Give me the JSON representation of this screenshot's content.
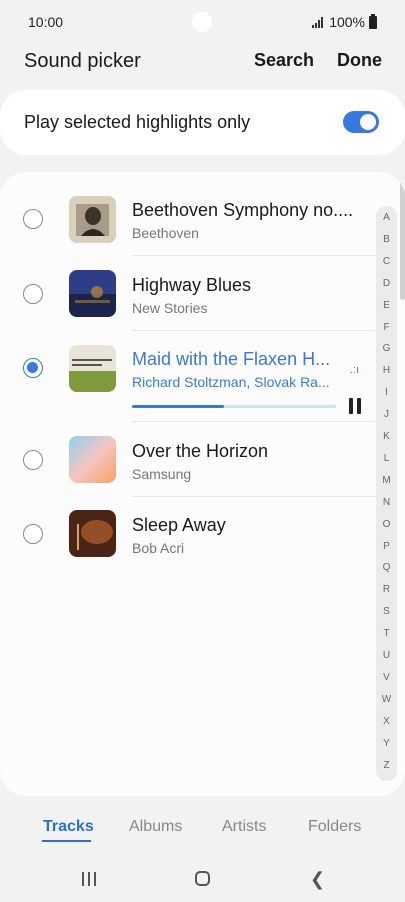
{
  "status": {
    "time": "10:00",
    "battery": "100%"
  },
  "header": {
    "title": "Sound picker",
    "search_label": "Search",
    "done_label": "Done"
  },
  "highlights": {
    "label": "Play selected highlights only",
    "enabled": true
  },
  "tracks": [
    {
      "title": "Beethoven Symphony no....",
      "artist": "Beethoven",
      "selected": false
    },
    {
      "title": "Highway Blues",
      "artist": "New Stories",
      "selected": false
    },
    {
      "title": "Maid with the Flaxen H...",
      "artist": "Richard Stoltzman, Slovak Ra...",
      "selected": true,
      "playing": true,
      "progress": 0.45
    },
    {
      "title": "Over the Horizon",
      "artist": "Samsung",
      "selected": false
    },
    {
      "title": "Sleep Away",
      "artist": "Bob Acri",
      "selected": false
    }
  ],
  "index_letters": [
    "A",
    "B",
    "C",
    "D",
    "E",
    "F",
    "G",
    "H",
    "I",
    "J",
    "K",
    "L",
    "M",
    "N",
    "O",
    "P",
    "Q",
    "R",
    "S",
    "T",
    "U",
    "V",
    "W",
    "X",
    "Y",
    "Z"
  ],
  "tabs": [
    {
      "label": "Tracks",
      "active": true
    },
    {
      "label": "Albums",
      "active": false
    },
    {
      "label": "Artists",
      "active": false
    },
    {
      "label": "Folders",
      "active": false
    }
  ],
  "colors": {
    "accent": "#3a78dd",
    "background": "#f2f2f2"
  },
  "icons": {
    "album_1": "album-art-beethoven",
    "album_2": "album-art-highway",
    "album_3": "album-art-stoltzman",
    "album_4": "album-art-horizon",
    "album_5": "album-art-sleep-away"
  }
}
